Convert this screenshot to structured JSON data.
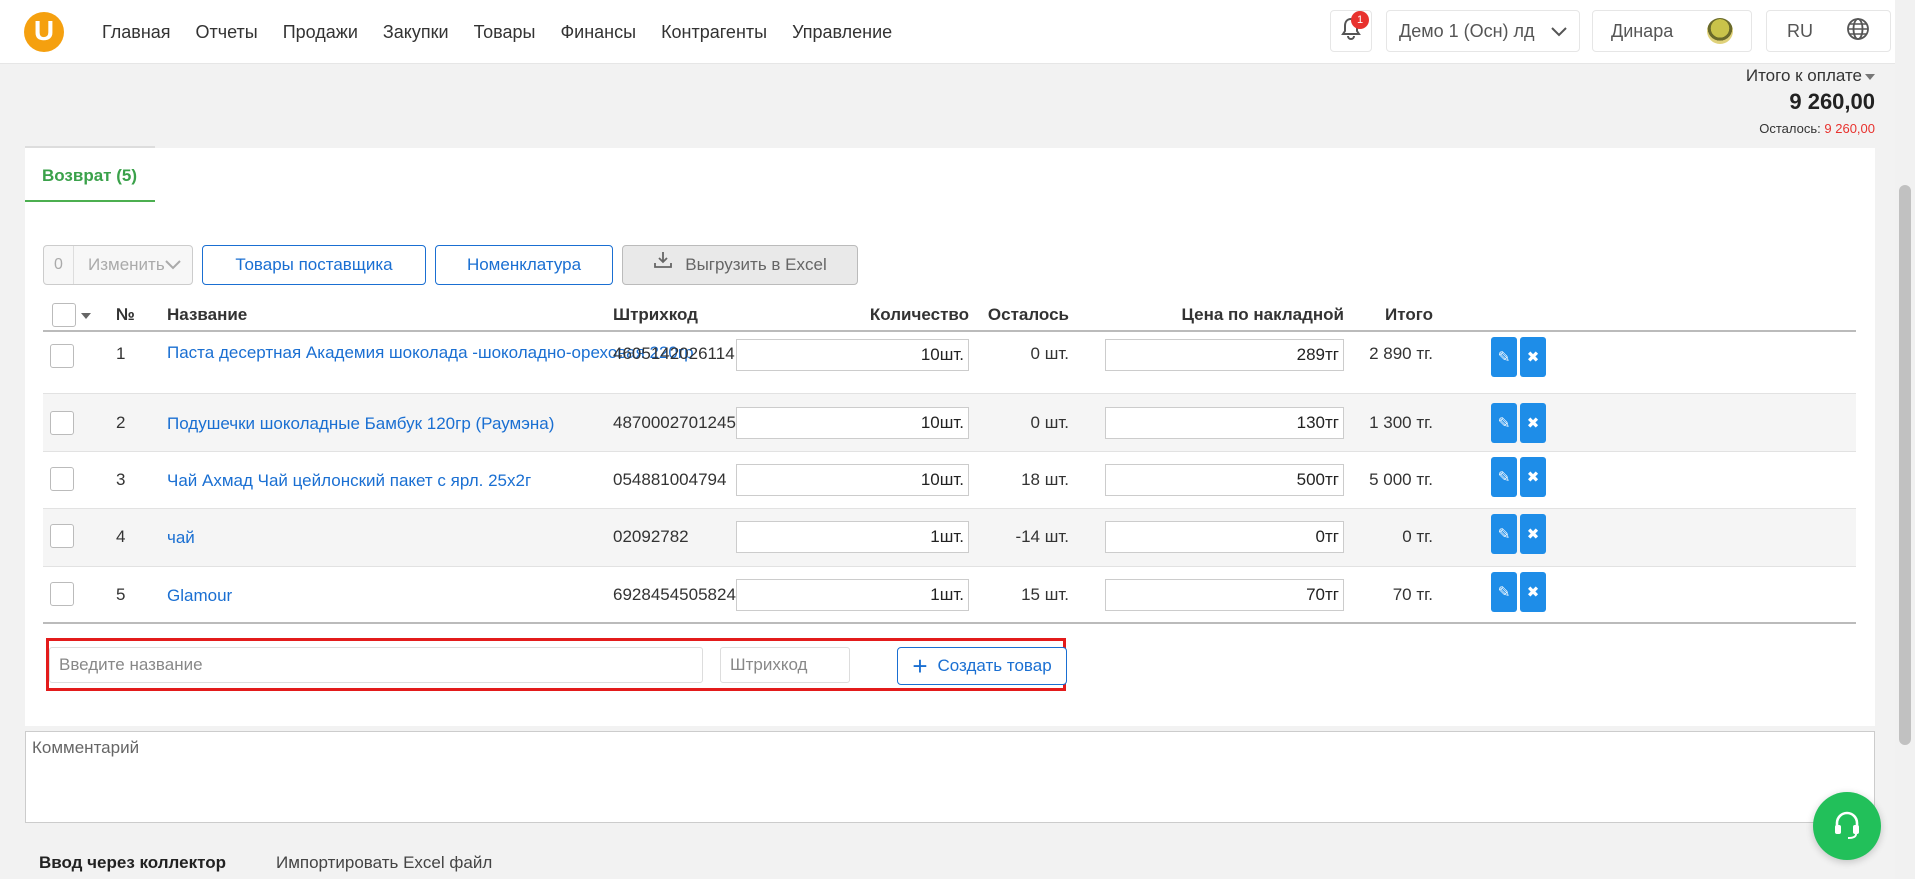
{
  "header": {
    "logo": "U",
    "nav": [
      "Главная",
      "Отчеты",
      "Продажи",
      "Закупки",
      "Товары",
      "Финансы",
      "Контрагенты",
      "Управление"
    ],
    "notifications_count": "1",
    "organization": "Демо 1 (Осн) лд",
    "user": "Динара",
    "language": "RU"
  },
  "totals": {
    "label": "Итого к оплате",
    "amount": "9 260,00",
    "rest_label": "Осталось:",
    "rest_value": "9 260,00"
  },
  "tab": {
    "label": "Возврат (5)"
  },
  "toolbar": {
    "selected_count": "0",
    "change_label": "Изменить",
    "supplier_goods": "Товары поставщика",
    "nomenclature": "Номенклатура",
    "export_excel": "Выгрузить в Excel"
  },
  "table": {
    "headers": {
      "num": "№",
      "name": "Название",
      "barcode": "Штрихкод",
      "qty": "Количество",
      "left": "Осталось",
      "price": "Цена по накладной",
      "total": "Итого"
    },
    "rows": [
      {
        "num": "1",
        "name": "Паста десертная Академия шоколада -шоколадно-ореховая 220гр",
        "barcode": "4605142026114",
        "qty": "10шт.",
        "left": "0 шт.",
        "price": "289тг",
        "total": "2 890 тг."
      },
      {
        "num": "2",
        "name": "Подушечки шоколадные Бамбук 120гр (Раумэна)",
        "barcode": "4870002701245",
        "qty": "10шт.",
        "left": "0 шт.",
        "price": "130тг",
        "total": "1 300 тг."
      },
      {
        "num": "3",
        "name": "Чай Ахмад Чай цейлонский пакет с ярл. 25х2г",
        "barcode": "054881004794",
        "qty": "10шт.",
        "left": "18 шт.",
        "price": "500тг",
        "total": "5 000 тг."
      },
      {
        "num": "4",
        "name": "чай",
        "barcode": "02092782",
        "qty": "1шт.",
        "left": "-14 шт.",
        "price": "0тг",
        "total": "0 тг."
      },
      {
        "num": "5",
        "name": "Glamour",
        "barcode": "6928454505824",
        "qty": "1шт.",
        "left": "15 шт.",
        "price": "70тг",
        "total": "70 тг."
      }
    ]
  },
  "new_item": {
    "name_placeholder": "Введите название",
    "barcode_placeholder": "Штрихкод",
    "create_label": "Создать товар"
  },
  "comment": {
    "placeholder": "Комментарий"
  },
  "bottom_tabs": [
    "Ввод через коллектор",
    "Импортировать Excel файл"
  ],
  "colors": {
    "accent": "#1a6fd2",
    "tab_green": "#3aa14a",
    "danger": "#e8322e",
    "action_blue": "#1e8de8",
    "support_green": "#22c05a"
  }
}
